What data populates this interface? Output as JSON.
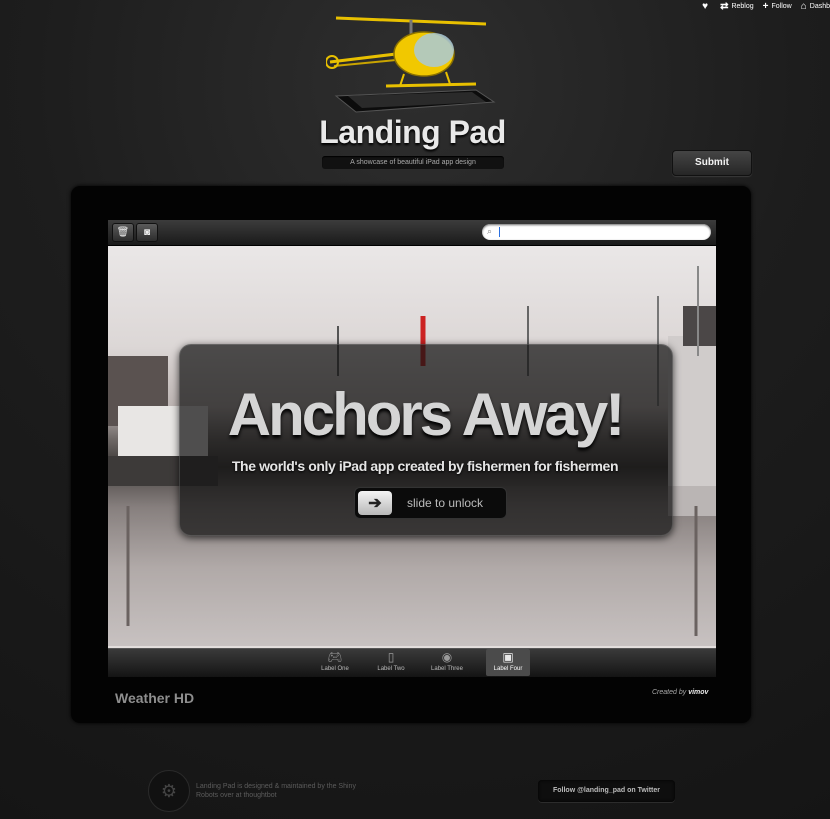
{
  "tumblr_bar": {
    "items": [
      {
        "icon": "heart-icon",
        "label": ""
      },
      {
        "icon": "reblog-icon",
        "label": "Reblog"
      },
      {
        "icon": "plus-icon",
        "label": "Follow"
      },
      {
        "icon": "home-icon",
        "label": "Dashb"
      }
    ]
  },
  "header": {
    "title": "Landing Pad",
    "tagline": "A showcase of beautiful iPad app design",
    "submit_label": "Submit"
  },
  "app_screen": {
    "toolbar_icons": [
      "trash-icon",
      "camera-icon"
    ],
    "search_placeholder": "",
    "headline": "Anchors Away!",
    "subheadline": "The world's only iPad app created by fishermen for fishermen",
    "slider_label": "slide to unlock",
    "tabs": [
      {
        "label": "Label One",
        "icon": "gamepad-icon"
      },
      {
        "label": "Label Two",
        "icon": "ipod-icon"
      },
      {
        "label": "Label Three",
        "icon": "disc-icon"
      },
      {
        "label": "Label Four",
        "icon": "monitor-icon"
      }
    ],
    "active_tab": 3
  },
  "showcase": {
    "app_name": "Weather HD",
    "credit_prefix": "Created by",
    "credit_author": "vimov"
  },
  "footer": {
    "text": "Landing Pad is designed & maintained by the Shiny Robots over at thoughtbot",
    "follow_label": "Follow @landing_pad on Twitter"
  }
}
